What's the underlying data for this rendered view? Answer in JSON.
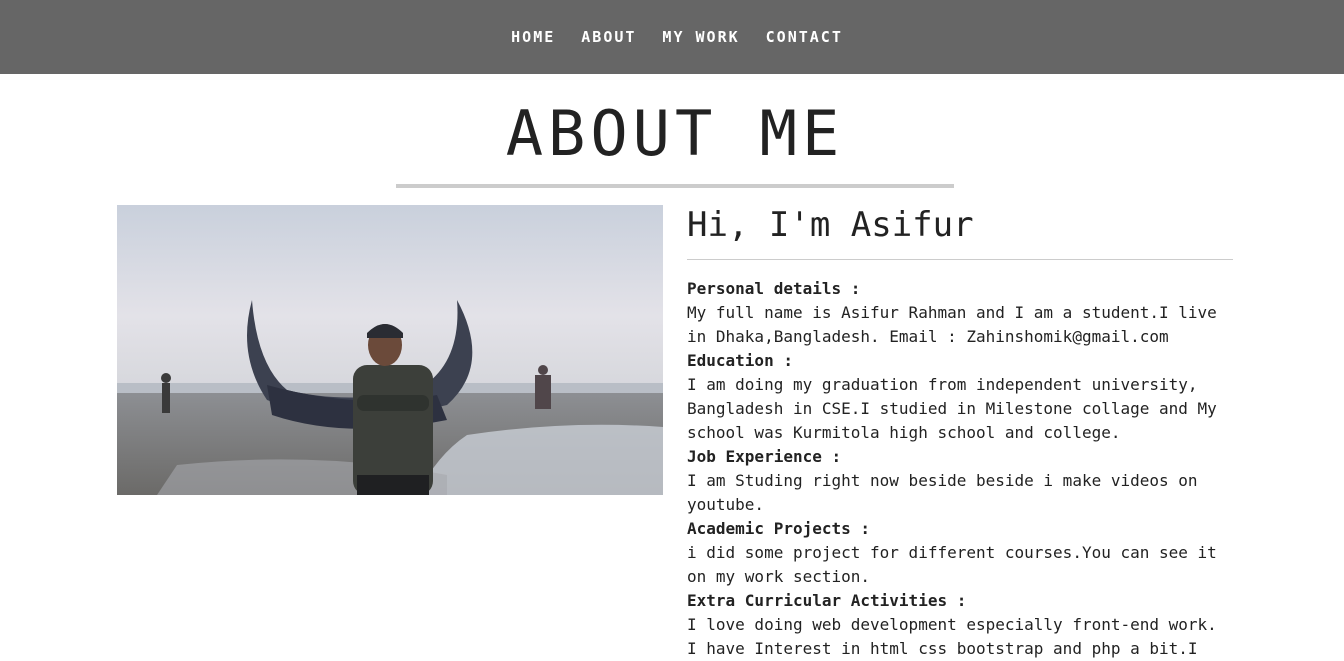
{
  "nav": {
    "items": [
      {
        "label": "HOME"
      },
      {
        "label": "ABOUT"
      },
      {
        "label": "MY WORK"
      },
      {
        "label": "CONTACT"
      }
    ]
  },
  "page": {
    "title": "ABOUT ME"
  },
  "profile": {
    "greeting": "Hi, I'm Asifur",
    "sections": [
      {
        "label": "Personal details :",
        "text": "My full name is Asifur Rahman and I am a student.I live in Dhaka,Bangladesh. Email : Zahinshomik@gmail.com"
      },
      {
        "label": "Education :",
        "text": "I am doing my graduation from independent university, Bangladesh in CSE.I studied in Milestone collage and My school was Kurmitola high school and college."
      },
      {
        "label": "Job Experience :",
        "text": "I am Studing right now beside beside i make videos on youtube."
      },
      {
        "label": "Academic Projects :",
        "text": "i did some project for different courses.You can see it on my work section."
      },
      {
        "label": "Extra Curricular Activities :",
        "text": "I love doing web development especially front-end work. I have Interest in html css bootstrap and php a bit.I"
      }
    ]
  },
  "colors": {
    "navbar_bg": "#666666",
    "text": "#222222",
    "rule": "#cccccc"
  }
}
